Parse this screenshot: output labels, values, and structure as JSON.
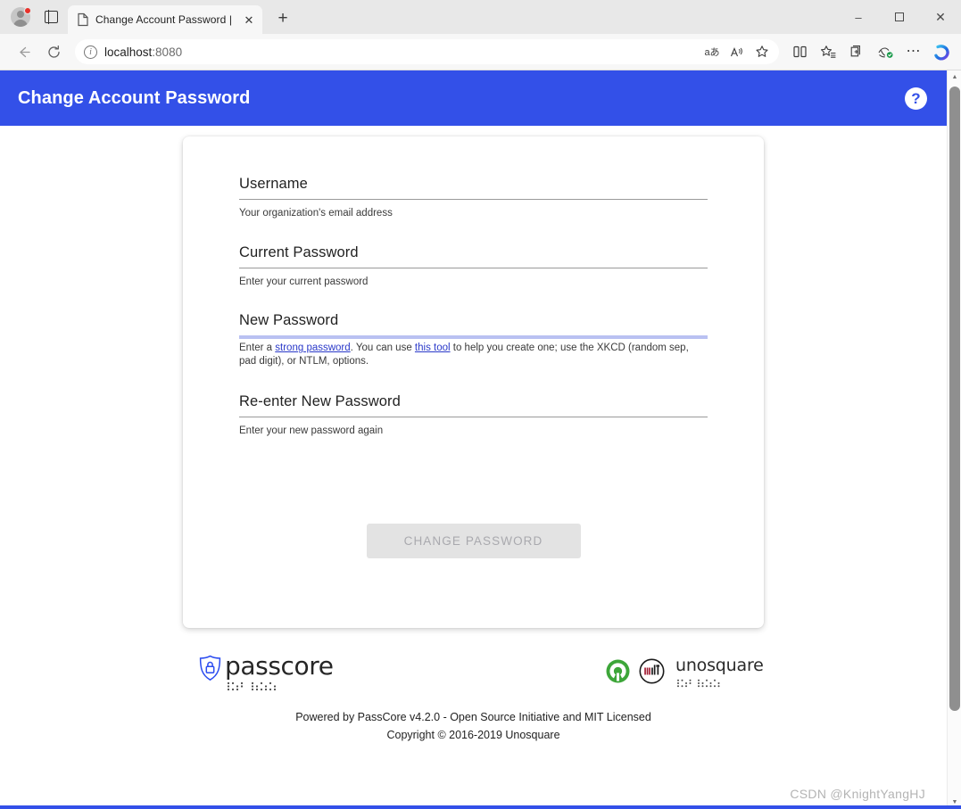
{
  "browser": {
    "profile_icon": "account-avatar",
    "notification_badge": true,
    "split_screen_icon": "split-screen-icon",
    "tab": {
      "favicon": "page-icon",
      "title": "Change Account Password | Self-",
      "close_label": "✕"
    },
    "new_tab_label": "+",
    "window_controls": {
      "minimize": "–",
      "maximize": "maximize-icon",
      "close": "✕"
    },
    "nav": {
      "back": "back-arrow-icon",
      "reload": "reload-icon",
      "site_info": "i"
    },
    "address": {
      "host": "localhost",
      "port": ":8080",
      "full": "localhost:8080"
    },
    "url_actions": [
      {
        "name": "read-aloud-translate-icon",
        "glyph": "aあ"
      },
      {
        "name": "immersive-reader-icon",
        "glyph": "A"
      },
      {
        "name": "favorite-star-icon",
        "glyph": "☆"
      }
    ],
    "toolbar_actions": [
      {
        "name": "split-screen-icon",
        "glyph": "split"
      },
      {
        "name": "favorites-icon",
        "glyph": "star-list"
      },
      {
        "name": "collections-icon",
        "glyph": "collections"
      },
      {
        "name": "browser-essentials-icon",
        "glyph": "essentials"
      },
      {
        "name": "settings-and-more-icon",
        "glyph": "⋯"
      },
      {
        "name": "copilot-icon",
        "glyph": "copilot"
      }
    ]
  },
  "app": {
    "header": {
      "title": "Change Account Password",
      "help_icon": "?"
    }
  },
  "form": {
    "fields": [
      {
        "key": "username",
        "label": "Username",
        "value": "",
        "placeholder": "",
        "hint": "Your organization's email address",
        "active": false
      },
      {
        "key": "current_password",
        "label": "Current Password",
        "value": "",
        "placeholder": "",
        "hint": "Enter your current password",
        "active": false
      },
      {
        "key": "new_password",
        "label": "New Password",
        "value": "",
        "placeholder": "",
        "hint_parts": {
          "before_link1": "Enter a ",
          "link1": "strong password",
          "between": ". You can use ",
          "link2": "this tool",
          "after": " to help you create one; use the XKCD (random sep, pad digit), or NTLM, options."
        },
        "active": true
      },
      {
        "key": "confirm_password",
        "label": "Re-enter New Password",
        "value": "",
        "placeholder": "",
        "hint": "Enter your new password again",
        "active": false
      }
    ],
    "submit": {
      "label": "CHANGE PASSWORD",
      "disabled": true
    }
  },
  "footer": {
    "passcore_logo": {
      "icon": "shield-lock-icon",
      "wordmark": "passcore"
    },
    "badges": [
      {
        "name": "open-source-initiative-logo"
      },
      {
        "name": "mit-license-logo",
        "text": "MIT"
      }
    ],
    "unosquare_logo": {
      "wordmark": "unosquare"
    },
    "line1": "Powered by PassCore v4.2.0 - Open Source Initiative and MIT Licensed",
    "line2": "Copyright © 2016-2019 Unosquare"
  },
  "watermark": "CSDN @KnightYangHJ",
  "colors": {
    "appbar_blue": "#3350e8",
    "link_blue": "#2a39c9",
    "active_underline": "#b9c1f2",
    "disabled_button_bg": "#e3e3e3",
    "disabled_button_text": "#a9a9ae",
    "shield_blue": "#2b4cf0",
    "osi_green": "#3da639",
    "mit_red": "#a31f34"
  }
}
